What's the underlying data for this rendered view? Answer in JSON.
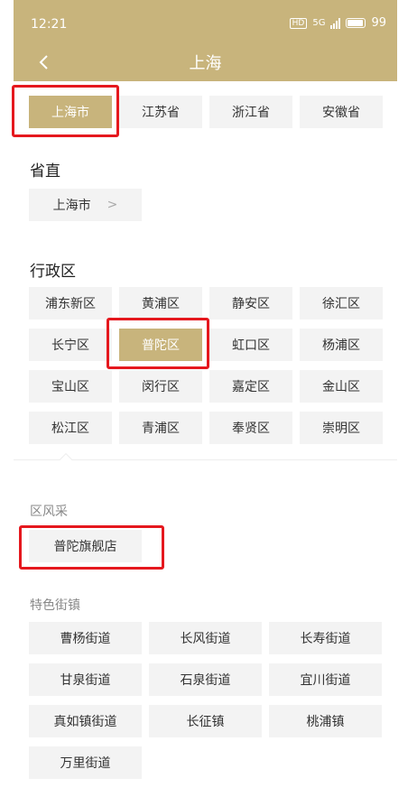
{
  "status": {
    "time": "12:21",
    "hd": "HD",
    "network": "5G",
    "battery": "99"
  },
  "header": {
    "title": "上海"
  },
  "regions": [
    "上海市",
    "江苏省",
    "浙江省",
    "安徽省"
  ],
  "province_direct": {
    "title": "省直",
    "item": "上海市",
    "arrow": ">"
  },
  "districts": {
    "title": "行政区",
    "items": [
      "浦东新区",
      "黄浦区",
      "静安区",
      "徐汇区",
      "长宁区",
      "普陀区",
      "虹口区",
      "杨浦区",
      "宝山区",
      "闵行区",
      "嘉定区",
      "金山区",
      "松江区",
      "青浦区",
      "奉贤区",
      "崇明区"
    ]
  },
  "district_style": {
    "title": "区风采",
    "item": "普陀旗舰店"
  },
  "streets": {
    "title": "特色街镇",
    "items": [
      "曹杨街道",
      "长风街道",
      "长寿街道",
      "甘泉街道",
      "石泉街道",
      "宜川街道",
      "真如镇街道",
      "长征镇",
      "桃浦镇",
      "万里街道"
    ]
  },
  "colors": {
    "accent": "#c8b47c",
    "highlight": "#e5181e",
    "chip_bg": "#f3f3f3"
  }
}
